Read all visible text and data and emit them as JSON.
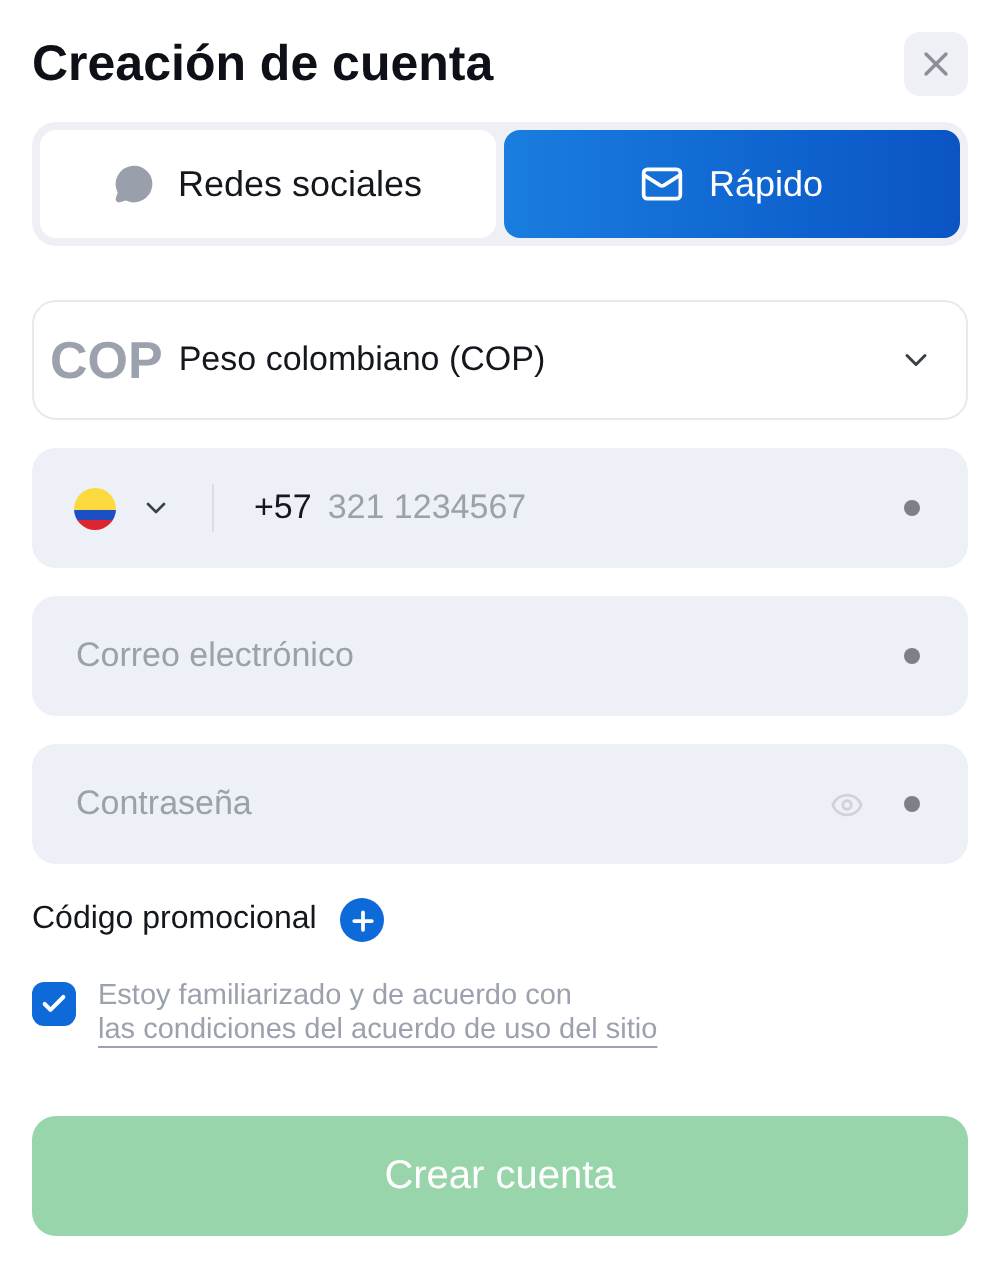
{
  "title": "Creación de cuenta",
  "tabs": [
    {
      "label": "Redes sociales",
      "kind": "social",
      "selected": false
    },
    {
      "label": "Rápido",
      "kind": "quick",
      "selected": true
    }
  ],
  "currency": {
    "code": "COP",
    "value": "Peso colombiano (COP)"
  },
  "phone": {
    "prefix": "+57",
    "placeholder": "321 1234567"
  },
  "fields": [
    {
      "kind": "email",
      "placeholder": "Correo electrónico"
    },
    {
      "kind": "password",
      "placeholder": "Contraseña"
    }
  ],
  "promo": {
    "label": "Código promocional"
  },
  "agreement": {
    "text": "Estoy familiarizado y de acuerdo con",
    "link": "las condiciones del acuerdo de uso del sitio",
    "checked": true
  },
  "submit": {
    "label": "Crear cuenta",
    "disabled": true
  }
}
